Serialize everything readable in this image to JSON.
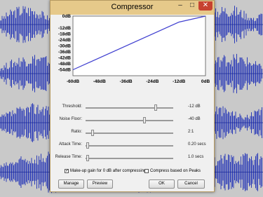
{
  "dialog": {
    "title": "Compressor",
    "window_buttons": {
      "minimize": "–",
      "maximize": "□",
      "close": "✕"
    }
  },
  "graph": {
    "y_labels": [
      "0dB",
      "-12dB",
      "-18dB",
      "-24dB",
      "-30dB",
      "-36dB",
      "-42dB",
      "-48dB",
      "-54dB"
    ],
    "x_labels": [
      "-60dB",
      "-48dB",
      "-36dB",
      "-24dB",
      "-12dB",
      "0dB"
    ]
  },
  "sliders": [
    {
      "label": "Threshold:",
      "value": "-12 dB",
      "level": 0.8
    },
    {
      "label": "Noise Floor:",
      "value": "-40 dB",
      "level": 0.67
    },
    {
      "label": "Ratio:",
      "value": "2:1",
      "level": 0.08
    },
    {
      "label": "Attack Time:",
      "value": "0.20 secs",
      "level": 0.02
    },
    {
      "label": "Release Time:",
      "value": "1.0 secs",
      "level": 0.02
    }
  ],
  "options": {
    "makeup_gain_label": "Make-up gain for 0 dB after compressing",
    "makeup_gain_checked": true,
    "peaks_label": "Compress based on Peaks",
    "peaks_checked": false
  },
  "buttons": {
    "manage": "Manage",
    "preview": "Preview",
    "ok": "OK",
    "cancel": "Cancel"
  },
  "colors": {
    "curve": "#4040d0",
    "waveform": "#2b3bb8",
    "titlebar": "#e6c98a"
  }
}
